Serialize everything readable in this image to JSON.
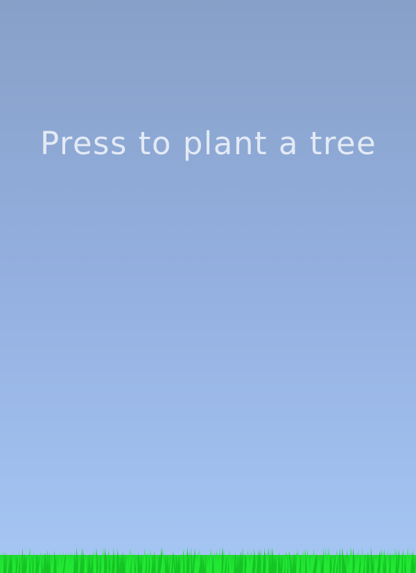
{
  "game": {
    "prompt": "Press to plant a tree"
  },
  "colors": {
    "sky_top": "#87a0c8",
    "sky_bottom": "#a6c6f4",
    "prompt_text": "#e3eaf5",
    "grass_light": "#22e834",
    "grass_dark": "#14c424"
  }
}
